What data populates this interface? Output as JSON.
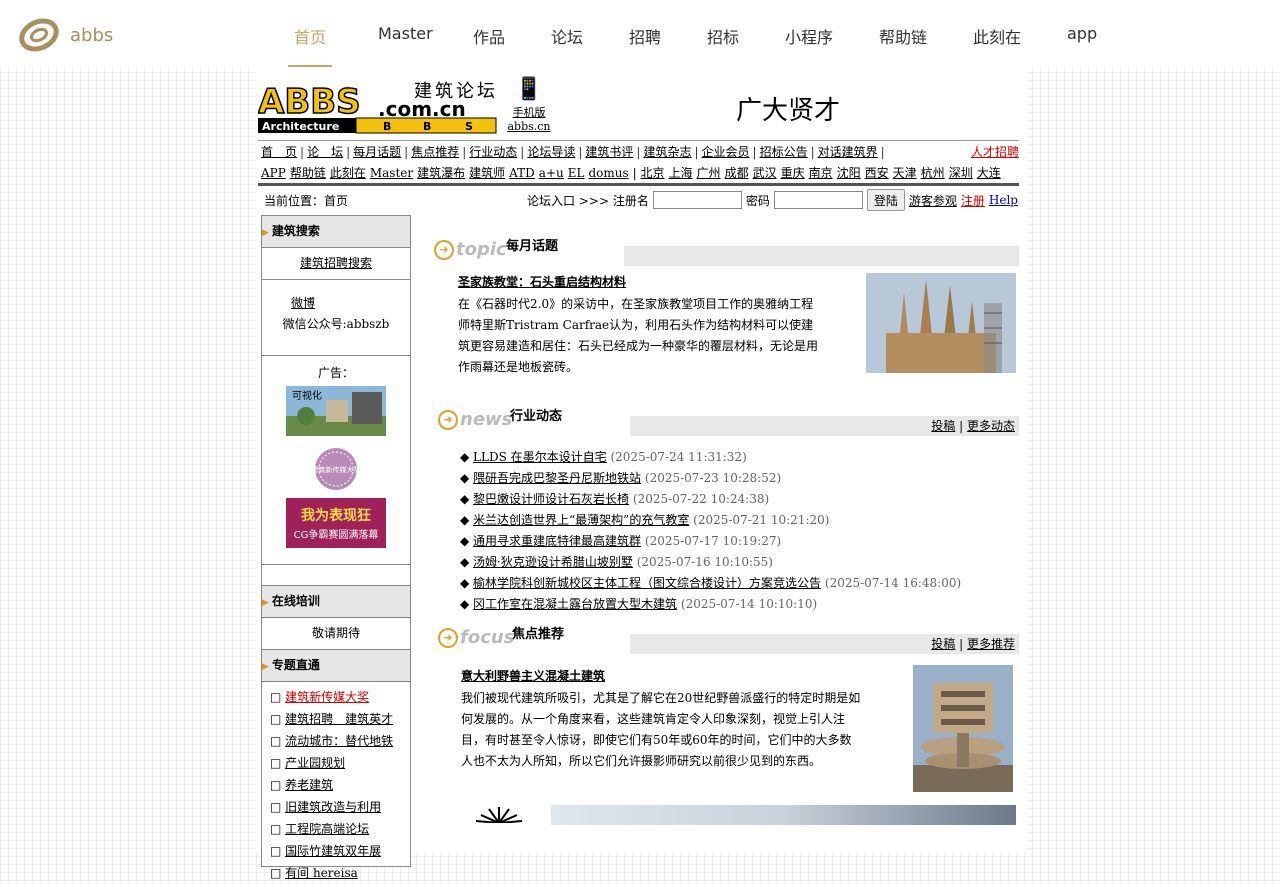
{
  "brand": {
    "name": "abbs"
  },
  "nav": {
    "items": [
      "首页",
      "Master",
      "作品",
      "论坛",
      "招聘",
      "招标",
      "小程序",
      "帮助链",
      "此刻在",
      "app"
    ],
    "active_index": 0
  },
  "header": {
    "logo_big": "ABBS",
    "logo_cn": "建筑论坛",
    "logo_domain": ".com.cn",
    "logo_bar": [
      "Architecture",
      "B",
      "B",
      "S"
    ],
    "mobile_label": "手机版",
    "mobile_domain": "abbs.cn",
    "slogan": "广大贤才"
  },
  "links_row1": [
    "首　页",
    "论　坛",
    "每月话题",
    "焦点推荐",
    "行业动态",
    "论坛导读",
    "建筑书评",
    "建筑杂志",
    "企业会员",
    "招标公告",
    "对话建筑界"
  ],
  "links_row1_right": "人才招聘",
  "links_row2": [
    "APP",
    "帮助链",
    "此刻在",
    "Master",
    "建筑瀑布",
    "建筑师",
    "ATD",
    "a+u",
    "EL",
    "domus",
    "北京",
    "上海",
    "广州",
    "成都",
    "武汉",
    "重庆",
    "南京",
    "沈阳",
    "西安",
    "天津",
    "杭州",
    "深圳",
    "大连"
  ],
  "breadcrumb": "当前位置：首页",
  "login": {
    "prefix": "论坛入口 >>> 注册名",
    "password_label": "密码",
    "button": "登陆",
    "guest": "游客参观",
    "register": "注册",
    "help": "Help"
  },
  "sidebar": {
    "search_title": "建筑搜索",
    "search_link": "建筑招聘搜索",
    "weibo": "微博",
    "wechat": "微信公众号:abbszb",
    "ad_label": "广告：",
    "ad1_text": "可视化",
    "ad2_text": "建筑新传媒大奖",
    "ad3_line1": "我为表现狂",
    "ad3_line2": "CG争霸赛圆满落幕",
    "training_title": "在线培训",
    "training_text": "敬请期待",
    "topics_title": "专题直通",
    "topics": [
      "建筑新传媒大奖",
      "建筑招聘　建筑英才",
      "流动城市：替代地铁",
      "产业园规划",
      "养老建筑",
      "旧建筑改造与利用",
      "工程院高端论坛",
      "国际竹建筑双年展",
      "有间 hereisa"
    ]
  },
  "topic": {
    "en": "topic",
    "cn": "每月话题",
    "title": "圣家族教堂：石头重启结构材料",
    "body": "在《石器时代2.0》的采访中，在圣家族教堂项目工作的奥雅纳工程师特里斯Tristram Carfrae认为，利用石头作为结构材料可以使建筑更容易建造和居住：石头已经成为一种豪华的覆层材料，无论是用作雨幕还是地板瓷砖。"
  },
  "news": {
    "en": "news",
    "cn": "行业动态",
    "submit": "投稿",
    "more": "更多动态",
    "items": [
      {
        "title": "LLDS 在墨尔本设计自宅",
        "date": "(2025-07-24 11:31:32)"
      },
      {
        "title": "隈研吾完成巴黎圣丹尼斯地铁站",
        "date": "(2025-07-23 10:28:52)"
      },
      {
        "title": "黎巴嫩设计师设计石灰岩长椅",
        "date": "(2025-07-22 10:24:38)"
      },
      {
        "title": "米兰达创造世界上“最薄架构”的充气教室",
        "date": "(2025-07-21 10:21:20)"
      },
      {
        "title": "通用寻求重建底特律最高建筑群",
        "date": "(2025-07-17 10:19:27)"
      },
      {
        "title": "汤姆·狄克逊设计希腊山坡别墅",
        "date": "(2025-07-16 10:10:55)"
      },
      {
        "title": "榆林学院科创新城校区主体工程（图文综合楼设计）方案竞选公告",
        "date": "(2025-07-14 16:48:00)"
      },
      {
        "title": "冈工作室在混凝土露台放置大型木建筑",
        "date": "(2025-07-14 10:10:10)"
      }
    ]
  },
  "focus": {
    "en": "focus",
    "cn": "焦点推荐",
    "submit": "投稿",
    "more": "更多推荐",
    "title": "意大利野兽主义混凝土建筑",
    "body": "我们被现代建筑所吸引，尤其是了解它在20世纪野兽派盛行的特定时期是如何发展的。从一个角度来看，这些建筑肯定令人印象深刻，视觉上引人注目，有时甚至令人惊讶，即使它们有50年或60年的时间，它们中的大多数人也不太为人所知，所以它们允许摄影师研究以前很少见到的东西。"
  }
}
